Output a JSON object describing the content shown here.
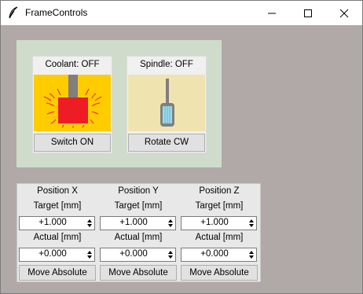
{
  "window": {
    "title": "FrameControls",
    "icons": [
      "feather-icon",
      "minimize-icon",
      "maximize-icon",
      "close-icon"
    ]
  },
  "coolant": {
    "label": "Coolant: OFF",
    "button": "Switch ON",
    "colors": {
      "background": "#ffcc00",
      "block": "#ee1c24",
      "stem": "#7f7f7f",
      "rays": "#ee1c24"
    }
  },
  "spindle": {
    "label": "Spindle: OFF",
    "button": "Rotate CW",
    "colors": {
      "background": "#efe4b0",
      "tool": "#7f7f7f",
      "bit": "#99d9ea"
    }
  },
  "axes": [
    {
      "header": "Position X",
      "target_label": "Target [mm]",
      "target_value": "+1.000",
      "actual_label": "Actual [mm]",
      "actual_value": "+0.000",
      "button": "Move Absolute"
    },
    {
      "header": "Position Y",
      "target_label": "Target [mm]",
      "target_value": "+1.000",
      "actual_label": "Actual [mm]",
      "actual_value": "+0.000",
      "button": "Move Absolute"
    },
    {
      "header": "Position Z",
      "target_label": "Target [mm]",
      "target_value": "+1.000",
      "actual_label": "Actual [mm]",
      "actual_value": "+0.000",
      "button": "Move Absolute"
    }
  ]
}
